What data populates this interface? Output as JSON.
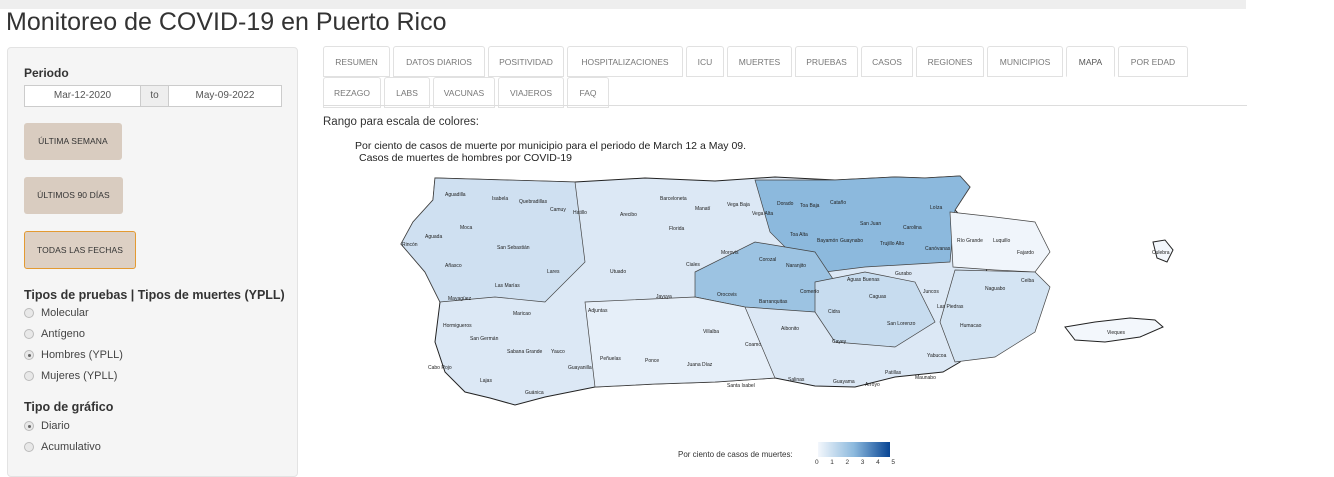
{
  "page": {
    "title": "Monitoreo de COVID-19 en Puerto Rico"
  },
  "sidebar": {
    "period_label": "Periodo",
    "date_start": "Mar-12-2020",
    "date_sep": "to",
    "date_end": "May-09-2022",
    "buttons": [
      "ÚLTIMA SEMANA",
      "ÚLTIMOS 90 DÍAS",
      "TODAS LAS FECHAS"
    ],
    "tests_heading": "Tipos de pruebas | Tipos de muertes (YPLL)",
    "test_options": [
      "Molecular",
      "Antígeno",
      "Hombres (YPLL)",
      "Mujeres (YPLL)"
    ],
    "test_selected": "Hombres (YPLL)",
    "chart_heading": "Tipo de gráfico",
    "chart_options": [
      "Diario",
      "Acumulativo"
    ],
    "chart_selected": "Diario"
  },
  "tabs": {
    "row1": [
      "RESUMEN",
      "DATOS DIARIOS",
      "POSITIVIDAD",
      "HOSPITALIZACIONES",
      "ICU",
      "MUERTES",
      "PRUEBAS",
      "CASOS",
      "REGIONES",
      "MUNICIPIOS",
      "MAPA",
      "POR EDAD"
    ],
    "row2": [
      "REZAGO",
      "LABS",
      "VACUNAS",
      "VIAJEROS",
      "FAQ"
    ],
    "active": "MAPA"
  },
  "main": {
    "scale_label": "Rango para escala de colores:",
    "map_title_line1": "Por ciento de casos de muerte por municipio para el periodo de March 12 a May 09.",
    "map_title_line2": "Casos de muertes de hombres por COVID-19",
    "legend_title": "Por ciento de casos de muertes:",
    "legend_ticks": [
      "0",
      "1",
      "2",
      "3",
      "4",
      "5"
    ],
    "colors": {
      "low": "#eef3fb",
      "mid": "#a9c8e4",
      "high": "#084594",
      "active_border": "#e39a32",
      "button_bg": "#d9ccc0"
    }
  },
  "municipios": [
    "Aguadilla",
    "Isabela",
    "Quebradillas",
    "Camuy",
    "Hatillo",
    "Arecibo",
    "Barceloneta",
    "Manatí",
    "Vega Baja",
    "Vega Alta",
    "Dorado",
    "Toa Baja",
    "Cataño",
    "Guaynabo",
    "San Juan",
    "Carolina",
    "Loíza",
    "Trujillo Alto",
    "Canóvanas",
    "Río Grande",
    "Luquillo",
    "Fajardo",
    "Culebra",
    "Ceiba",
    "Naguabo",
    "Humacao",
    "Las Piedras",
    "Yabucoa",
    "Maunabo",
    "Patillas",
    "Arroyo",
    "Guayama",
    "Salinas",
    "Santa Isabel",
    "Juana Díaz",
    "Ponce",
    "Peñuelas",
    "Guayanilla",
    "Yauco",
    "Guánica",
    "Lajas",
    "Cabo Rojo",
    "Sabana Grande",
    "San Germán",
    "Hormigueros",
    "Mayagüez",
    "Añasco",
    "Rincón",
    "Aguada",
    "Moca",
    "San Sebastián",
    "Las Marías",
    "Maricao",
    "Lares",
    "Utuado",
    "Adjuntas",
    "Jayuya",
    "Ciales",
    "Florida",
    "Morovis",
    "Corozal",
    "Orocovis",
    "Barranquitas",
    "Villalba",
    "Coamo",
    "Aibonito",
    "Comerío",
    "Naranjito",
    "Toa Alta",
    "Bayamón",
    "Cidra",
    "Cayey",
    "Aguas Buenas",
    "Caguas",
    "Gurabo",
    "Juncos",
    "San Lorenzo",
    "Vieques"
  ]
}
